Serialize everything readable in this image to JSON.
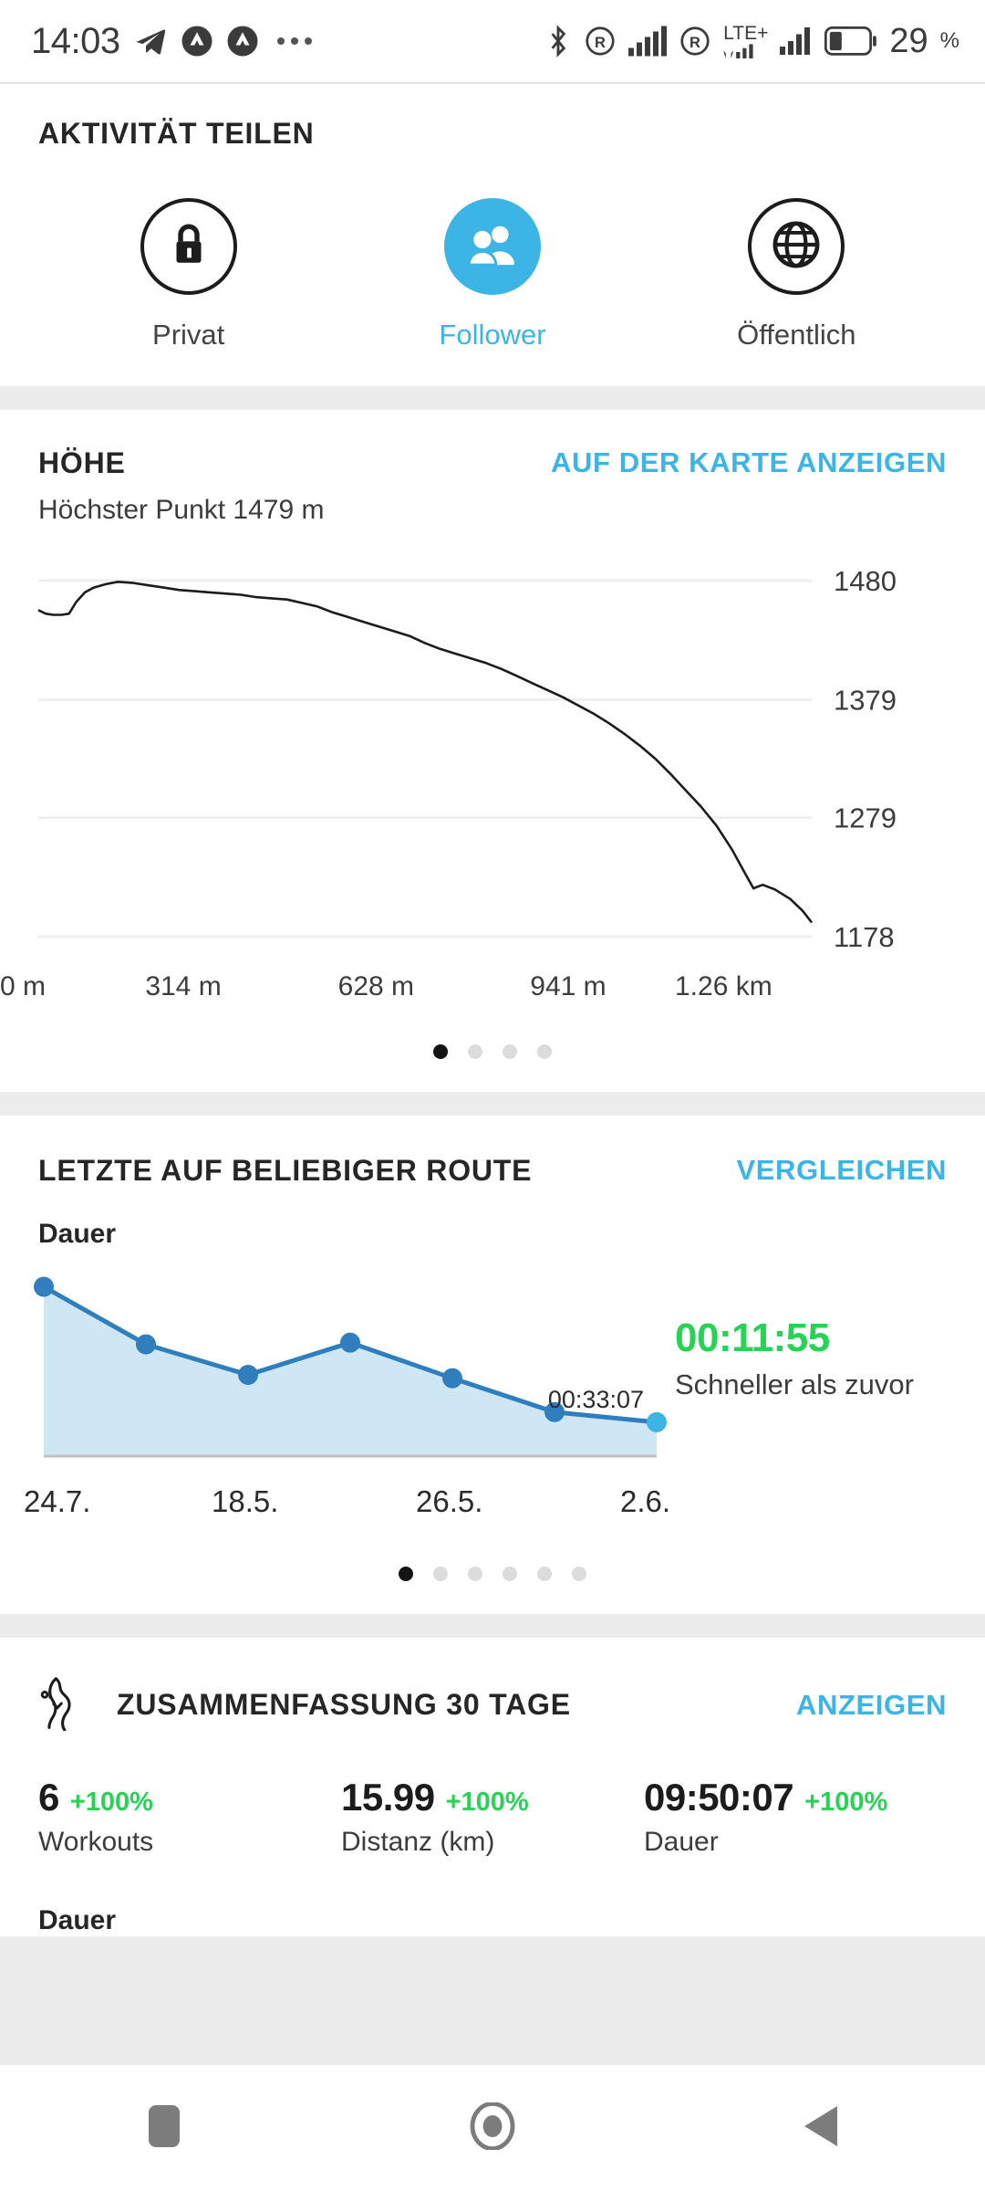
{
  "statusbar": {
    "time": "14:03",
    "icons_left": [
      "telegram-icon",
      "app-notification-icon",
      "app-notification-icon",
      "more-dots-icon"
    ],
    "bluetooth_icon": "bluetooth-icon",
    "roaming_icon_1": "roaming-r-icon",
    "signal_icon_1": "signal-bars-icon",
    "roaming_icon_2": "roaming-r-icon",
    "network_type": "LTE+",
    "signal_icon_2": "signal-bars-icon",
    "battery_icon": "battery-icon",
    "battery_level": "29",
    "battery_unit": "%"
  },
  "share": {
    "title": "AKTIVITÄT TEILEN",
    "options": [
      {
        "label": "Privat",
        "icon": "lock-icon",
        "active": false
      },
      {
        "label": "Follower",
        "icon": "people-icon",
        "active": true
      },
      {
        "label": "Öffentlich",
        "icon": "globe-icon",
        "active": false
      }
    ]
  },
  "elevation": {
    "title": "HÖHE",
    "action": "AUF DER KARTE ANZEIGEN",
    "subtitle": "Höchster Punkt 1479 m",
    "pager": {
      "count": 4,
      "active": 0
    }
  },
  "route": {
    "title": "LETZTE AUF BELIEBIGER ROUTE",
    "action": "VERGLEICHEN",
    "metric_label": "Dauer",
    "last_value_label": "00:33:07",
    "improvement_time": "00:11:55",
    "improvement_text": "Schneller als zuvor",
    "pager": {
      "count": 6,
      "active": 0
    }
  },
  "summary": {
    "icon": "route-map-icon",
    "title": "ZUSAMMENFASSUNG 30 TAGE",
    "action": "ANZEIGEN",
    "stats": [
      {
        "value": "6",
        "delta": "+100%",
        "name": "Workouts"
      },
      {
        "value": "15.99",
        "delta": "+100%",
        "name": "Distanz (km)"
      },
      {
        "value": "09:50:07",
        "delta": "+100%",
        "name": "Dauer"
      }
    ],
    "metric_label": "Dauer"
  },
  "navbar": {
    "recents": "recents-square-icon",
    "home": "home-circle-icon",
    "back": "back-triangle-icon"
  },
  "colors": {
    "accent": "#3cb4e5",
    "green": "#27d254",
    "text": "#262626",
    "line": "#2f7fbf",
    "area": "#cfe6f4"
  },
  "chart_data": [
    {
      "type": "line",
      "title": "HÖHE",
      "subtitle": "Höchster Punkt 1479 m",
      "xlabel": "",
      "ylabel": "",
      "ytick_labels": [
        "1480",
        "1379",
        "1279",
        "1178"
      ],
      "ytick_values": [
        1480,
        1379,
        1279,
        1178
      ],
      "xtick_labels": [
        "0 m",
        "314 m",
        "628 m",
        "941 m",
        "1.26 km"
      ],
      "xtick_values": [
        0,
        314,
        628,
        941,
        1260
      ],
      "ylim": [
        1178,
        1480
      ],
      "xlim": [
        0,
        1260
      ],
      "grid": true,
      "legend": "none",
      "series": [
        {
          "name": "Höhe",
          "x": [
            0,
            12,
            24,
            38,
            50,
            62,
            76,
            90,
            110,
            130,
            155,
            180,
            205,
            230,
            255,
            280,
            305,
            330,
            355,
            380,
            405,
            430,
            455,
            480,
            505,
            530,
            555,
            580,
            605,
            630,
            655,
            680,
            705,
            730,
            755,
            780,
            805,
            830,
            855,
            880,
            905,
            930,
            955,
            980,
            1005,
            1030,
            1055,
            1080,
            1105,
            1130,
            1150,
            1165,
            1180,
            1200,
            1225,
            1245,
            1260
          ],
          "values": [
            1455,
            1452,
            1451,
            1451,
            1452,
            1462,
            1470,
            1474,
            1477,
            1479,
            1478,
            1476,
            1474,
            1472,
            1471,
            1470,
            1469,
            1468,
            1466,
            1465,
            1464,
            1461,
            1458,
            1453,
            1449,
            1445,
            1441,
            1437,
            1433,
            1427,
            1422,
            1418,
            1414,
            1410,
            1405,
            1399,
            1393,
            1387,
            1381,
            1374,
            1367,
            1359,
            1350,
            1340,
            1329,
            1316,
            1302,
            1288,
            1272,
            1252,
            1233,
            1219,
            1222,
            1218,
            1210,
            1200,
            1190
          ]
        }
      ]
    },
    {
      "type": "area",
      "title": "LETZTE AUF BELIEBIGER ROUTE",
      "ylabel": "Dauer",
      "xlabel": "",
      "categories": [
        "24.7.",
        "",
        "18.5.",
        "",
        "26.5.",
        "",
        "2.6."
      ],
      "xtick_labels": [
        "24.7.",
        "18.5.",
        "26.5.",
        "2.6."
      ],
      "xtick_indices": [
        0,
        2,
        4,
        6
      ],
      "values": [
        100,
        66,
        48,
        67,
        46,
        26,
        20
      ],
      "point_labels": [
        "",
        "",
        "",
        "",
        "",
        "",
        "00:33:07"
      ],
      "highlight_index": 6,
      "grid": false,
      "legend": "none",
      "annotation": {
        "time": "00:11:55",
        "text": "Schneller als zuvor"
      }
    }
  ]
}
